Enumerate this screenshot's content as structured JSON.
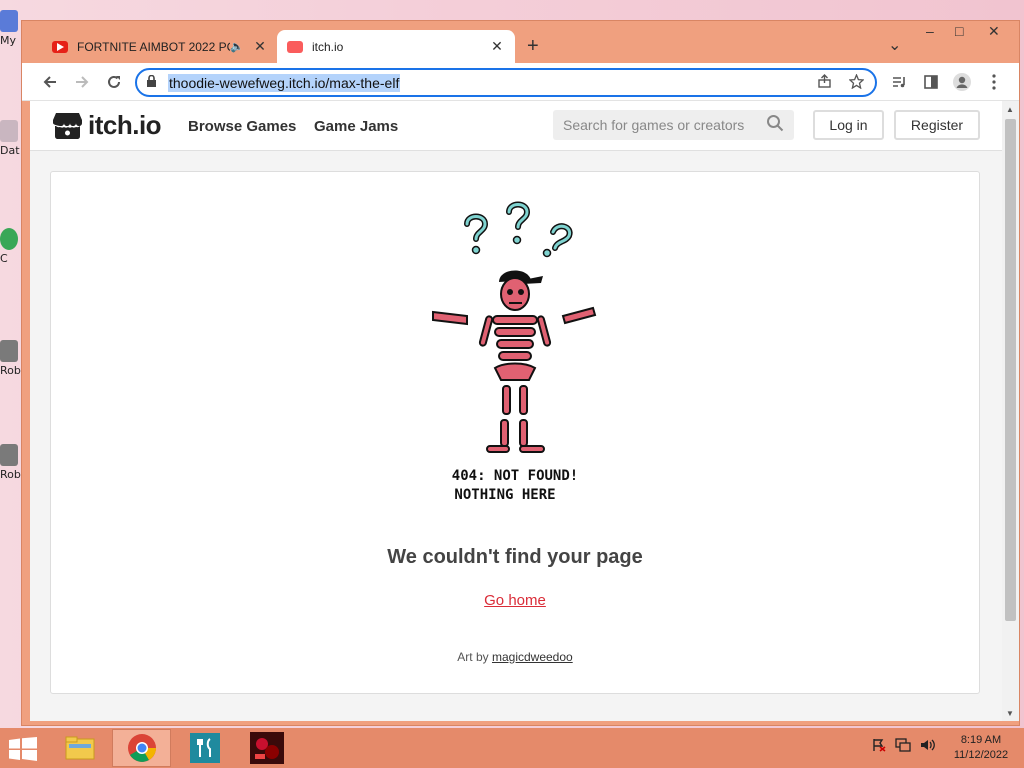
{
  "desktop": {
    "icons": [
      "My",
      "Dat",
      "C",
      "Rob",
      "Rob"
    ]
  },
  "browser": {
    "tabs": [
      {
        "title": "FORTNITE AIMBOT 2022 PC",
        "active": false,
        "audio": "🔈",
        "close": "✕"
      },
      {
        "title": "itch.io",
        "active": true,
        "close": "✕"
      }
    ],
    "new_tab": "+",
    "url": "thoodie-wewefweg.itch.io/max-the-elf",
    "window_controls": {
      "minimize": "–",
      "restore": "□",
      "close": "✕",
      "tab_list": "⌄"
    }
  },
  "site": {
    "logo_text": "itch.io",
    "nav": [
      "Browse Games",
      "Game Jams"
    ],
    "search_placeholder": "Search for games or creators",
    "login": "Log in",
    "register": "Register"
  },
  "error_page": {
    "art_text_line1": "404: NOT FOUND!",
    "art_text_line2": "NOTHING HERE",
    "heading": "We couldn't find your page",
    "go_home": "Go home",
    "credit_prefix": "Art by",
    "credit_artist": "magicdweedoo"
  },
  "taskbar": {
    "apps": [
      "file-explorer",
      "chrome",
      "app-fork-knife",
      "game-thumbnail"
    ],
    "clock_time": "8:19 AM",
    "clock_date": "11/12/2022"
  },
  "colors": {
    "window_frame": "#f0a07f",
    "taskbar": "#e58a6a",
    "accent_link": "#da2c38",
    "omnibox_focus": "#1a73e8"
  }
}
